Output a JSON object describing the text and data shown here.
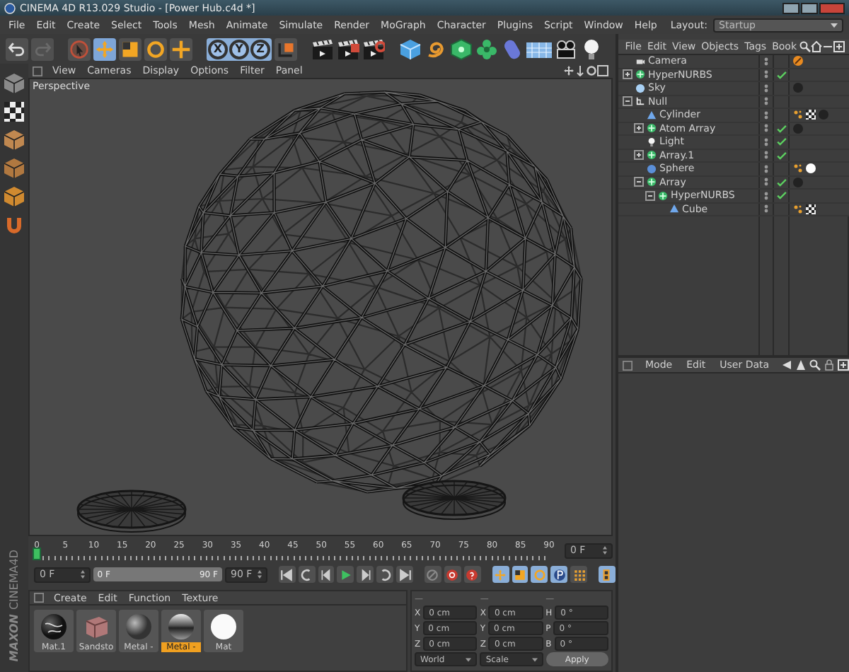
{
  "window": {
    "title": "CINEMA 4D R13.029 Studio - [Power Hub.c4d *]"
  },
  "menu_bar": {
    "items": [
      "File",
      "Edit",
      "Create",
      "Select",
      "Tools",
      "Mesh",
      "Animate",
      "Simulate",
      "Render",
      "MoGraph",
      "Character",
      "Plugins",
      "Script",
      "Window",
      "Help"
    ],
    "layout_label": "Layout:",
    "layout_value": "Startup"
  },
  "toolbar": {
    "tools": [
      {
        "kind": "select",
        "selected": false
      },
      {
        "kind": "move",
        "selected": true
      },
      {
        "kind": "scale",
        "selected": false
      },
      {
        "kind": "rotate",
        "selected": false
      },
      {
        "kind": "crosshair",
        "selected": false
      }
    ],
    "axis_buttons": [
      {
        "label": "X",
        "on": true
      },
      {
        "label": "Y",
        "on": true
      },
      {
        "label": "Z",
        "on": true
      }
    ]
  },
  "viewport": {
    "menu": [
      "View",
      "Cameras",
      "Display",
      "Options",
      "Filter",
      "Panel"
    ],
    "camera_label": "Perspective"
  },
  "object_manager": {
    "menu": [
      "File",
      "Edit",
      "View",
      "Objects",
      "Tags",
      "Book"
    ],
    "objects": [
      {
        "name": "Camera",
        "kind": "camera",
        "check": false,
        "tags": [
          {
            "kind": "target"
          }
        ]
      },
      {
        "name": "HyperNURBS",
        "kind": "generator",
        "expanded": false,
        "check": true
      },
      {
        "name": "Sky",
        "kind": "sky",
        "check": false,
        "tags": [
          {
            "kind": "material",
            "color": "#222222"
          }
        ]
      },
      {
        "name": "Null",
        "kind": "null",
        "expanded": true,
        "check": false,
        "children": [
          {
            "name": "Cylinder",
            "kind": "primitive",
            "check": false,
            "tags": [
              {
                "kind": "phong"
              },
              {
                "kind": "checker"
              },
              {
                "kind": "material",
                "color": "#222222"
              }
            ]
          },
          {
            "name": "Atom Array",
            "kind": "generator",
            "expanded": false,
            "check": true,
            "tags": [
              {
                "kind": "material",
                "color": "#222222"
              }
            ]
          },
          {
            "name": "Light",
            "kind": "light",
            "check": true
          },
          {
            "name": "Array.1",
            "kind": "generator",
            "expanded": false,
            "check": true
          },
          {
            "name": "Sphere",
            "kind": "sphere",
            "check": false,
            "tags": [
              {
                "kind": "phong"
              },
              {
                "kind": "material",
                "color": "#ffffff"
              }
            ]
          },
          {
            "name": "Array",
            "kind": "generator",
            "expanded": true,
            "check": true,
            "tags": [
              {
                "kind": "material",
                "color": "#222222"
              }
            ],
            "children": [
              {
                "name": "HyperNURBS",
                "kind": "generator",
                "expanded": true,
                "check": true,
                "children": [
                  {
                    "name": "Cube",
                    "kind": "primitive",
                    "check": false,
                    "tags": [
                      {
                        "kind": "phong"
                      },
                      {
                        "kind": "checker"
                      }
                    ]
                  }
                ]
              }
            ]
          }
        ]
      }
    ]
  },
  "attribute_manager": {
    "menu": [
      "Mode",
      "Edit",
      "User Data"
    ]
  },
  "timeline": {
    "ticks": [
      "0",
      "5",
      "10",
      "15",
      "20",
      "25",
      "30",
      "35",
      "40",
      "45",
      "50",
      "55",
      "60",
      "65",
      "70",
      "75",
      "80",
      "85",
      "90"
    ],
    "current_frame": "0 F"
  },
  "playback": {
    "start_field": "0 F",
    "range_start": "0 F",
    "range_end": "90 F",
    "level": 1,
    "end_field": "90 F"
  },
  "materials": {
    "menu": [
      "Create",
      "Edit",
      "Function",
      "Texture"
    ],
    "items": [
      {
        "name": "Mat.1",
        "kind": "marble",
        "selected": false
      },
      {
        "name": "Sandsto",
        "kind": "box",
        "selected": false
      },
      {
        "name": "Metal -",
        "kind": "matte",
        "selected": false
      },
      {
        "name": "Metal -",
        "kind": "chrome",
        "selected": true
      },
      {
        "name": "Mat",
        "kind": "white",
        "selected": false
      }
    ]
  },
  "coordinates": {
    "headers": [
      "—",
      "—",
      "—"
    ],
    "columns": [
      {
        "rows": [
          {
            "label": "X",
            "value": "0 cm"
          },
          {
            "label": "Y",
            "value": "0 cm"
          },
          {
            "label": "Z",
            "value": "0 cm"
          }
        ]
      },
      {
        "rows": [
          {
            "label": "X",
            "value": "0 cm"
          },
          {
            "label": "Y",
            "value": "0 cm"
          },
          {
            "label": "Z",
            "value": "0 cm"
          }
        ]
      },
      {
        "rows": [
          {
            "label": "H",
            "value": "0 °"
          },
          {
            "label": "P",
            "value": "0 °"
          },
          {
            "label": "B",
            "value": "0 °"
          }
        ]
      }
    ],
    "mode_dropdown": "World",
    "size_dropdown": "Scale",
    "apply_button": "Apply"
  },
  "logo": {
    "brand": "MAXON",
    "product": "CINEMA4D"
  }
}
